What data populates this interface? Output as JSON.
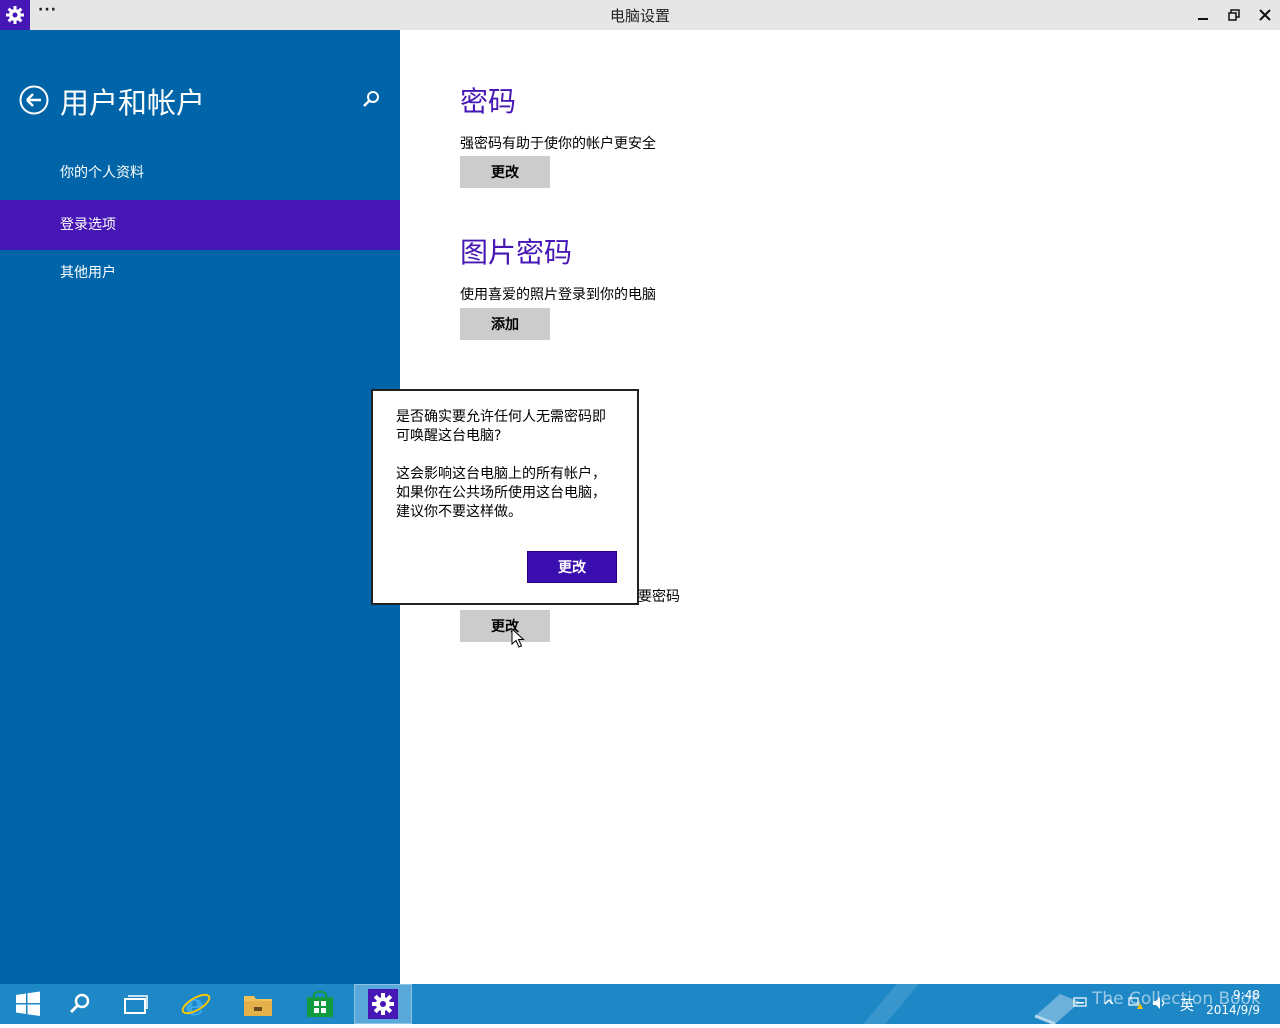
{
  "window": {
    "title": "电脑设置",
    "menu_label": "···",
    "minimize_icon": "minimize-icon",
    "restore_icon": "restore-icon",
    "close_icon": "close-icon"
  },
  "sidebar": {
    "title": "用户和帐户",
    "items": [
      {
        "label": "你的个人资料",
        "selected": false
      },
      {
        "label": "登录选项",
        "selected": true
      },
      {
        "label": "其他用户",
        "selected": false
      }
    ]
  },
  "sections": {
    "password": {
      "title": "密码",
      "desc": "强密码有助于使你的帐户更安全",
      "button": "更改"
    },
    "picture_password": {
      "title": "图片密码",
      "desc": "使用喜爱的照片登录到你的电脑",
      "button": "添加"
    },
    "require_password": {
      "desc_tail": "要密码",
      "button": "更改"
    }
  },
  "dialog": {
    "question": "是否确实要允许任何人无需密码即可唤醒这台电脑?",
    "body": "这会影响这台电脑上的所有帐户，如果你在公共场所使用这台电脑，建议你不要这样做。",
    "button": "更改"
  },
  "taskbar": {
    "items": [
      "start-icon",
      "search-icon",
      "task-view-icon",
      "ie-icon",
      "file-explorer-icon",
      "store-icon",
      "settings-icon"
    ],
    "active": "settings-icon",
    "ime": "英",
    "time": "9:48",
    "date": "2014/9/9",
    "watermark": "The Collection Book"
  },
  "colors": {
    "accent": "#4617b4",
    "sidebar_bg": "#0064a8",
    "taskbar_bg": "#1e88c7",
    "button_gray": "#cccccc"
  }
}
